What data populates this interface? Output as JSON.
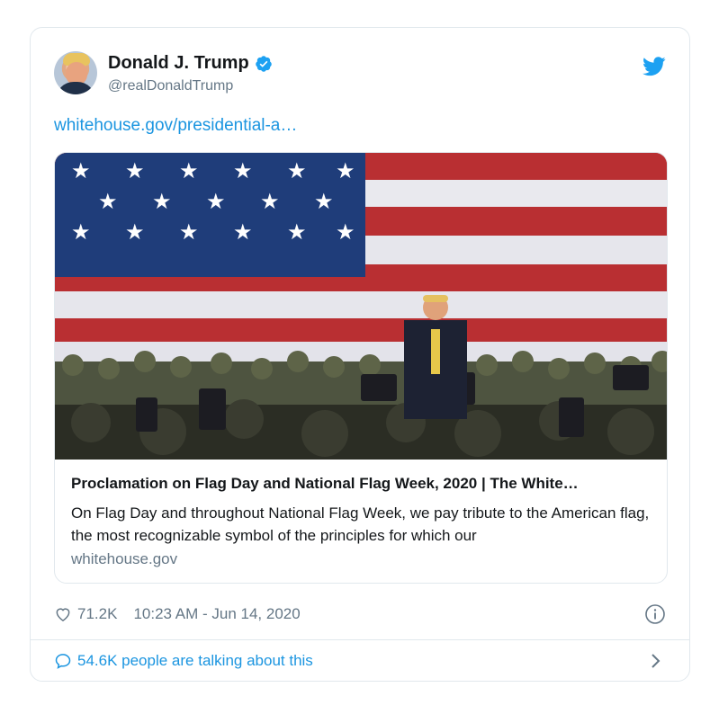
{
  "tweet": {
    "author_name": "Donald J. Trump",
    "author_handle": "@realDonaldTrump",
    "link_text": "whitehouse.gov/presidential-a…",
    "likes": "71.2K",
    "timestamp": "10:23 AM - Jun 14, 2020",
    "talking": "54.6K people are talking about this"
  },
  "link_card": {
    "title": "Proclamation on Flag Day and National Flag Week, 2020 | The White…",
    "description": "On Flag Day and throughout National Flag Week, we pay tribute to the American flag, the most recognizable symbol of the principles for which our",
    "domain": "whitehouse.gov"
  },
  "icons": {
    "verified": "verified-badge-icon",
    "brand": "twitter-bird-icon",
    "like": "heart-icon",
    "info": "info-icon",
    "reply": "speech-bubble-icon",
    "more": "chevron-right-icon"
  },
  "colors": {
    "link_blue": "#1b95e0",
    "verified_blue": "#1da1f2",
    "secondary_text": "#657786",
    "border": "#e1e8ed"
  }
}
